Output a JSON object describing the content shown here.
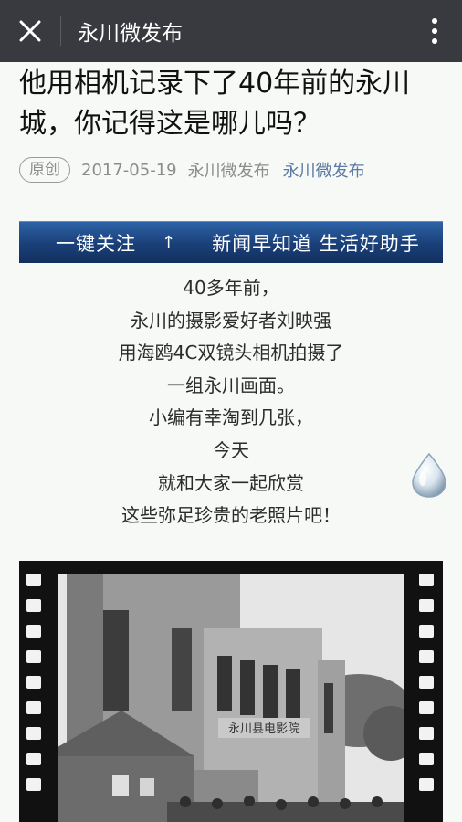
{
  "topbar": {
    "title": "永川微发布",
    "close_icon": "close-icon",
    "more_icon": "more-vertical-icon"
  },
  "article": {
    "title": "他用相机记录下了40年前的永川城，你记得这是哪儿吗？",
    "tag": "原创",
    "date": "2017-05-19",
    "author": "永川微发布",
    "account": "永川微发布"
  },
  "banner": {
    "left_text": "一键关注",
    "arrow": "↑",
    "right_text": "新闻早知道 生活好助手"
  },
  "poem": {
    "lines": [
      "40多年前，",
      "永川的摄影爱好者刘映强",
      "用海鸥4C双镜头相机拍摄了",
      "一组永川画面。",
      "小编有幸淘到几张，",
      "今天",
      "就和大家一起欣赏",
      "这些弥足珍贵的老照片吧！"
    ]
  },
  "photo": {
    "sign_text": "永川县电影院"
  },
  "colors": {
    "topbar": "#393a3f",
    "account_link": "#5c7aa3",
    "banner": "#1f4a8a"
  }
}
